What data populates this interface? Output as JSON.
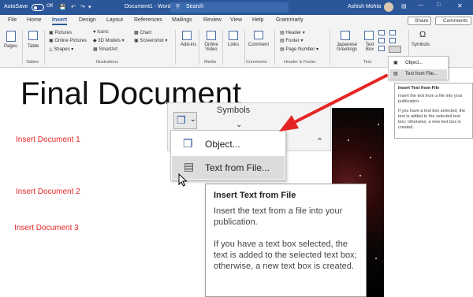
{
  "titlebar": {
    "autosave": "AutoSave",
    "autosave_state": "Off",
    "doc_title": "Document1 - Word",
    "search": "Search",
    "user": "Ashish Mohta"
  },
  "tabs": [
    "File",
    "Home",
    "Insert",
    "Design",
    "Layout",
    "References",
    "Mailings",
    "Review",
    "View",
    "Help",
    "Grammarly"
  ],
  "tab_actions": {
    "share": "Share",
    "comments": "Comments"
  },
  "ribbon": {
    "pages": "Pages",
    "table": "Table",
    "tables_group": "Tables",
    "pictures": "Pictures",
    "online_pictures": "Online Pictures",
    "shapes": "Shapes",
    "icons": "Icons",
    "models": "3D Models",
    "smartart": "SmartArt",
    "chart": "Chart",
    "screenshot": "Screenshot",
    "illustrations_group": "Illustrations",
    "addins": "Add-ins",
    "online_video": "Online Video",
    "media_group": "Media",
    "links": "Links",
    "comment": "Comment",
    "comments_group": "Comments",
    "header": "Header",
    "footer": "Footer",
    "page_number": "Page Number",
    "header_footer_group": "Header & Footer",
    "japanese_greetings": "Japanese Greetings",
    "text_box": "Text Box",
    "text_group": "Text",
    "symbols": "Symbols"
  },
  "small_menu": {
    "object": "Object...",
    "text_from_file": "Text from File..."
  },
  "small_tooltip": {
    "title": "Insert Text from File",
    "p1": "Insert the text from a file into your publication.",
    "p2": "If you have a text box selected, the text is added to the selected text box; otherwise, a new text box is created."
  },
  "document": {
    "title": "Final Document",
    "items": [
      "Insert Document 1",
      "Insert Document 2",
      "Insert Document 3"
    ]
  },
  "flyout": {
    "symbols": "Symbols"
  },
  "menu": {
    "object": "Object...",
    "text_from_file": "Text from File..."
  },
  "tooltip": {
    "title": "Insert Text from File",
    "p1": "Insert the text from a file into your publication.",
    "p2": "If you have a text box selected, the text is added to the selected text box; otherwise, a new text box is created."
  },
  "colors": {
    "word_blue": "#2b579a",
    "annotation_red": "#e52525"
  }
}
